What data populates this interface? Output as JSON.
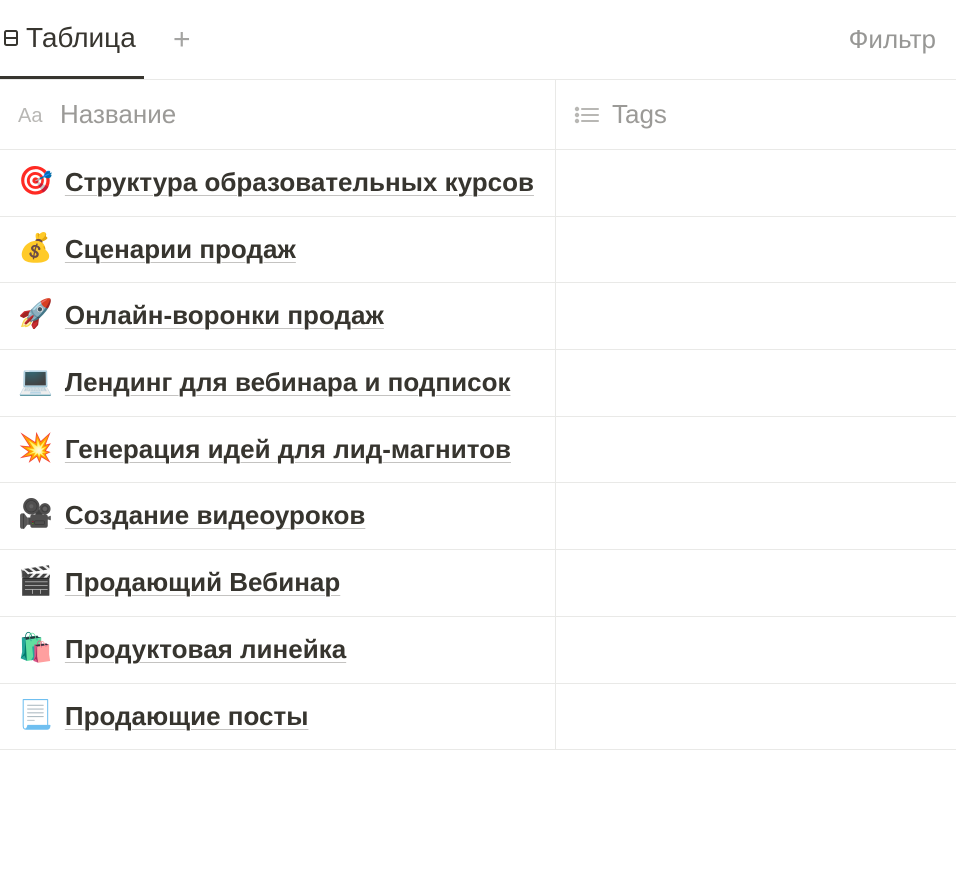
{
  "tabs": {
    "active_label": "Таблица"
  },
  "toolbar": {
    "filter_label": "Фильтр"
  },
  "columns": {
    "name_label": "Название",
    "tags_label": "Tags"
  },
  "rows": [
    {
      "emoji": "🎯",
      "title": "Структура образовательных курсов"
    },
    {
      "emoji": "💰",
      "title": "Сценарии продаж"
    },
    {
      "emoji": "🚀",
      "title": "Онлайн-воронки продаж"
    },
    {
      "emoji": "💻",
      "title": "Лендинг для вебинара и подписок"
    },
    {
      "emoji": "💥",
      "title": "Генерация идей для лид-магнитов"
    },
    {
      "emoji": "🎥",
      "title": "Создание видеоуроков"
    },
    {
      "emoji": "🎬",
      "title": "Продающий Вебинар"
    },
    {
      "emoji": "🛍️",
      "title": "Продуктовая линейка"
    },
    {
      "emoji": "📃",
      "title": "Продающие посты"
    }
  ]
}
